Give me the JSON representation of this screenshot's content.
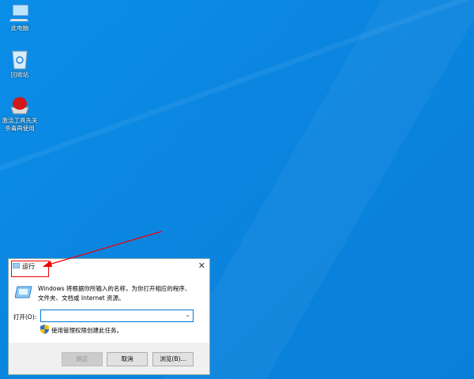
{
  "desktop": {
    "icons": [
      {
        "label": "此电脑"
      },
      {
        "label": "回收站"
      },
      {
        "label": "激活工具先关",
        "label2": "杀毒再使用"
      }
    ]
  },
  "run_dialog": {
    "title": "运行",
    "description_line1": "Windows 将根据你所输入的名称，为你打开相应的程序、",
    "description_line2": "文件夹、文档或 Internet 资源。",
    "open_label": "打开(O):",
    "open_value": "",
    "admin_note": "使用管理权限创建此任务。",
    "ok_label": "确定",
    "cancel_label": "取消",
    "browse_label": "浏览(B)...",
    "close_glyph": "✕"
  },
  "annotation": {
    "color": "#e00000"
  }
}
